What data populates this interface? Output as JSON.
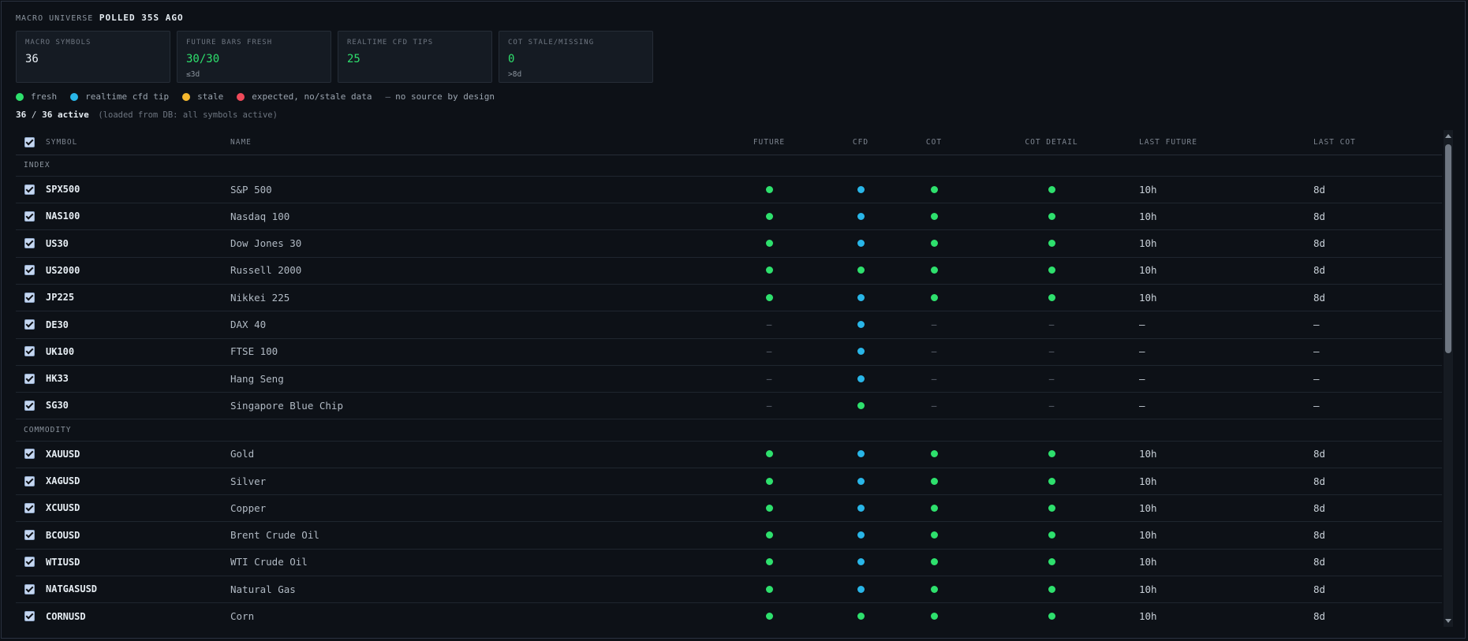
{
  "header": {
    "prefix": "MACRO UNIVERSE",
    "status": "POLLED 35S AGO"
  },
  "cards": [
    {
      "label": "MACRO SYMBOLS",
      "value": "36",
      "sub": "",
      "tone": "white"
    },
    {
      "label": "FUTURE BARS FRESH",
      "value": "30/30",
      "sub": "≤3d",
      "tone": "green"
    },
    {
      "label": "REALTIME CFD TIPS",
      "value": "25",
      "sub": "",
      "tone": "green"
    },
    {
      "label": "COT STALE/MISSING",
      "value": "0",
      "sub": ">8d",
      "tone": "green"
    }
  ],
  "legend": [
    {
      "label": "fresh",
      "color": "#2ee06d"
    },
    {
      "label": "realtime cfd tip",
      "color": "#29b6e8"
    },
    {
      "label": "stale",
      "color": "#f5b82e"
    },
    {
      "label": "expected, no/stale data",
      "color": "#ef4a5a"
    }
  ],
  "legend_dash": {
    "symbol": "—",
    "label": "no source by design"
  },
  "active": {
    "count": "36",
    "sep": " / ",
    "total": "36",
    "word": " active",
    "note": "(loaded from DB: all symbols active)"
  },
  "colors": {
    "fresh": "#2ee06d",
    "cfd": "#29b6e8",
    "stale": "#f5b82e",
    "missing": "#ef4a5a"
  },
  "columns": [
    "SYMBOL",
    "NAME",
    "FUTURE",
    "CFD",
    "COT",
    "COT DETAIL",
    "LAST FUTURE",
    "LAST COT"
  ],
  "groups": [
    {
      "label": "INDEX",
      "rows": [
        {
          "symbol": "SPX500",
          "name": "S&P 500",
          "future": "fresh",
          "cfd": "cfd",
          "cot": "fresh",
          "cot_detail": "fresh",
          "last_future": "10h",
          "last_cot": "8d"
        },
        {
          "symbol": "NAS100",
          "name": "Nasdaq 100",
          "future": "fresh",
          "cfd": "cfd",
          "cot": "fresh",
          "cot_detail": "fresh",
          "last_future": "10h",
          "last_cot": "8d"
        },
        {
          "symbol": "US30",
          "name": "Dow Jones 30",
          "future": "fresh",
          "cfd": "cfd",
          "cot": "fresh",
          "cot_detail": "fresh",
          "last_future": "10h",
          "last_cot": "8d"
        },
        {
          "symbol": "US2000",
          "name": "Russell 2000",
          "future": "fresh",
          "cfd": "fresh",
          "cot": "fresh",
          "cot_detail": "fresh",
          "last_future": "10h",
          "last_cot": "8d"
        },
        {
          "symbol": "JP225",
          "name": "Nikkei 225",
          "future": "fresh",
          "cfd": "cfd",
          "cot": "fresh",
          "cot_detail": "fresh",
          "last_future": "10h",
          "last_cot": "8d"
        },
        {
          "symbol": "DE30",
          "name": "DAX 40",
          "future": "none",
          "cfd": "cfd",
          "cot": "none",
          "cot_detail": "none",
          "last_future": "—",
          "last_cot": "—"
        },
        {
          "symbol": "UK100",
          "name": "FTSE 100",
          "future": "none",
          "cfd": "cfd",
          "cot": "none",
          "cot_detail": "none",
          "last_future": "—",
          "last_cot": "—"
        },
        {
          "symbol": "HK33",
          "name": "Hang Seng",
          "future": "none",
          "cfd": "cfd",
          "cot": "none",
          "cot_detail": "none",
          "last_future": "—",
          "last_cot": "—"
        },
        {
          "symbol": "SG30",
          "name": "Singapore Blue Chip",
          "future": "none",
          "cfd": "fresh",
          "cot": "none",
          "cot_detail": "none",
          "last_future": "—",
          "last_cot": "—"
        }
      ]
    },
    {
      "label": "COMMODITY",
      "rows": [
        {
          "symbol": "XAUUSD",
          "name": "Gold",
          "future": "fresh",
          "cfd": "cfd",
          "cot": "fresh",
          "cot_detail": "fresh",
          "last_future": "10h",
          "last_cot": "8d"
        },
        {
          "symbol": "XAGUSD",
          "name": "Silver",
          "future": "fresh",
          "cfd": "cfd",
          "cot": "fresh",
          "cot_detail": "fresh",
          "last_future": "10h",
          "last_cot": "8d"
        },
        {
          "symbol": "XCUUSD",
          "name": "Copper",
          "future": "fresh",
          "cfd": "cfd",
          "cot": "fresh",
          "cot_detail": "fresh",
          "last_future": "10h",
          "last_cot": "8d"
        },
        {
          "symbol": "BCOUSD",
          "name": "Brent Crude Oil",
          "future": "fresh",
          "cfd": "cfd",
          "cot": "fresh",
          "cot_detail": "fresh",
          "last_future": "10h",
          "last_cot": "8d"
        },
        {
          "symbol": "WTIUSD",
          "name": "WTI Crude Oil",
          "future": "fresh",
          "cfd": "cfd",
          "cot": "fresh",
          "cot_detail": "fresh",
          "last_future": "10h",
          "last_cot": "8d"
        },
        {
          "symbol": "NATGASUSD",
          "name": "Natural Gas",
          "future": "fresh",
          "cfd": "cfd",
          "cot": "fresh",
          "cot_detail": "fresh",
          "last_future": "10h",
          "last_cot": "8d"
        },
        {
          "symbol": "CORNUSD",
          "name": "Corn",
          "future": "fresh",
          "cfd": "fresh",
          "cot": "fresh",
          "cot_detail": "fresh",
          "last_future": "10h",
          "last_cot": "8d"
        }
      ]
    }
  ]
}
